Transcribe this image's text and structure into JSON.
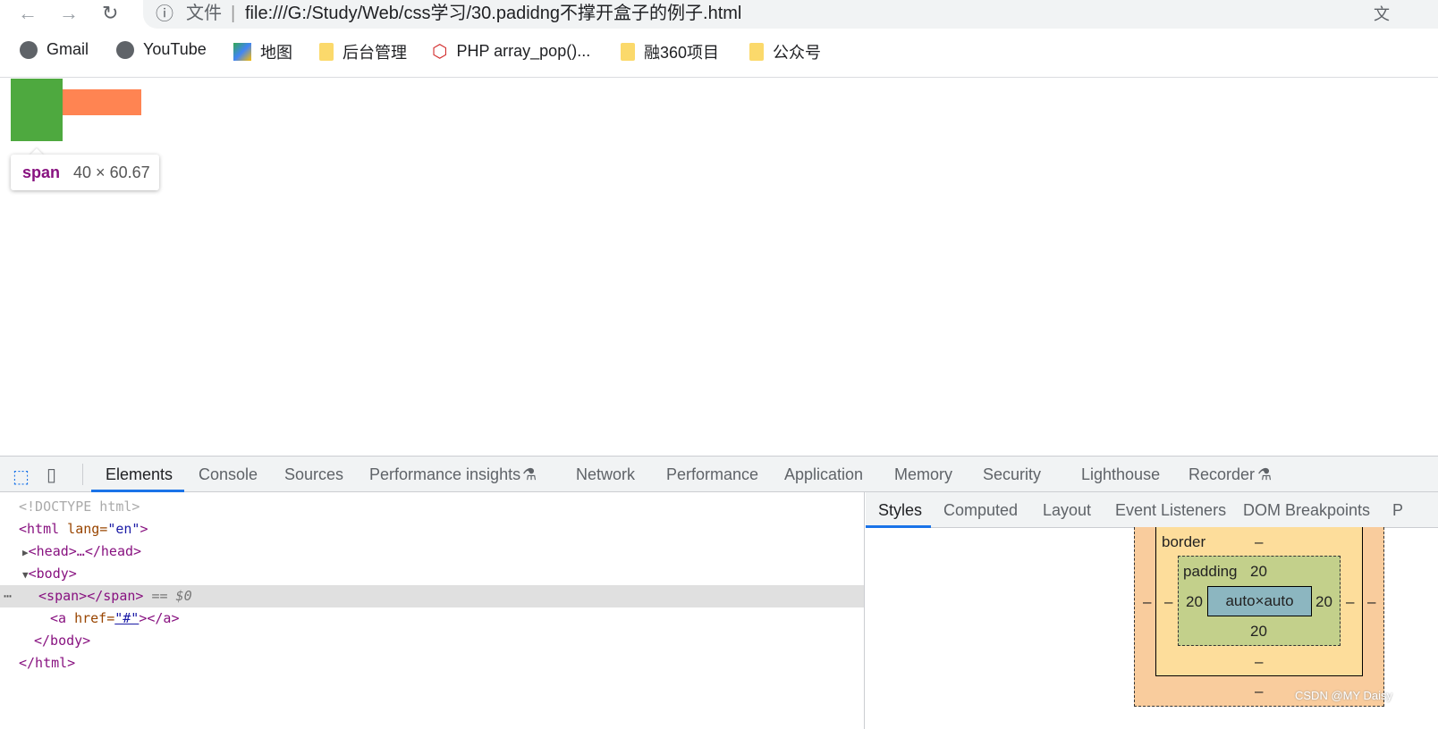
{
  "browser": {
    "url_label": "文件",
    "url": "file:///G:/Study/Web/css学习/30.padidng不撑开盒子的例子.html"
  },
  "bookmarks": [
    {
      "label": "Gmail",
      "icon": "globe-icon"
    },
    {
      "label": "YouTube",
      "icon": "globe-icon"
    },
    {
      "label": "地图",
      "icon": "maps-icon"
    },
    {
      "label": "后台管理",
      "icon": "folder-icon"
    },
    {
      "label": "PHP array_pop()...",
      "icon": "php-icon"
    },
    {
      "label": "融360项目",
      "icon": "folder-icon"
    },
    {
      "label": "公众号",
      "icon": "folder-icon"
    }
  ],
  "page": {
    "colors": {
      "span": "#4ea93f",
      "link": "#ff8452"
    },
    "tooltip": {
      "tag": "span",
      "size": "40 × 60.67"
    }
  },
  "devtools": {
    "tabs": [
      "Elements",
      "Console",
      "Sources",
      "Performance insights",
      "Network",
      "Performance",
      "Application",
      "Memory",
      "Security",
      "Lighthouse",
      "Recorder"
    ],
    "dom": {
      "l0": "<!DOCTYPE html>",
      "l1a": "<html",
      "l1b": " lang=",
      "l1c": "\"en\"",
      "l1d": ">",
      "l2": "<head>…</head>",
      "l3": "<body>",
      "l4": "<span></span>",
      "l4b": " == $0",
      "l5a": "<a",
      "l5b": " href=",
      "l5c": "\"#\"",
      "l5d": "></a>",
      "l6": "</body>",
      "l7": "</html>"
    },
    "side_tabs": [
      "Styles",
      "Computed",
      "Layout",
      "Event Listeners",
      "DOM Breakpoints",
      "P"
    ],
    "box": {
      "border_label": "border",
      "border": "–",
      "padding_label": "padding",
      "pad_top": "20",
      "pad_left": "20",
      "pad_right": "20",
      "pad_bottom": "20",
      "content": "auto×auto",
      "dash": "–"
    },
    "watermark": "CSDN @MY Daisy"
  }
}
